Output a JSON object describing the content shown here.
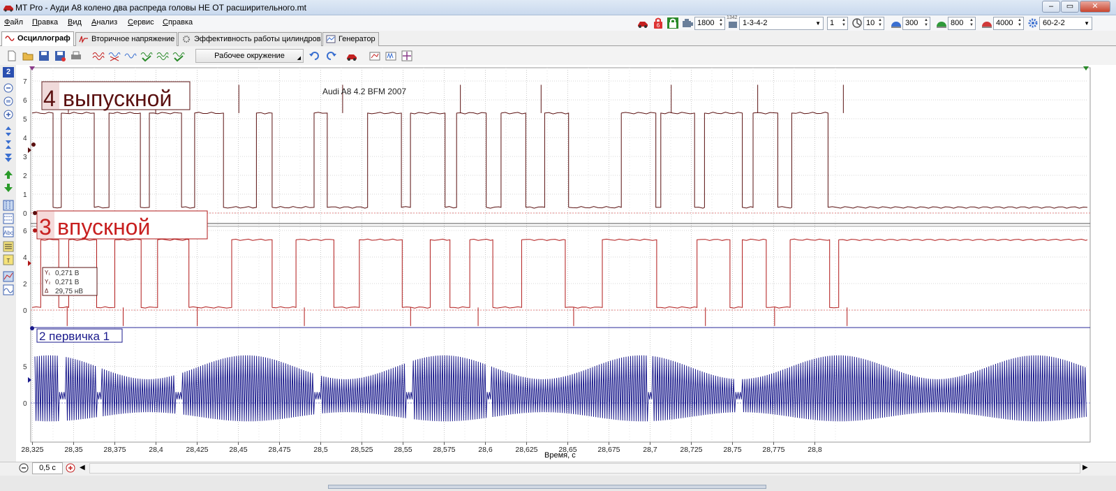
{
  "window": {
    "title": "MT Pro - Ауди А8 колено два распреда головы НЕ ОТ расширительного.mt",
    "minimize": "–",
    "maximize": "▭",
    "close": "✕"
  },
  "menu": {
    "items": [
      "Файл",
      "Правка",
      "Вид",
      "Анализ",
      "Сервис",
      "Справка"
    ]
  },
  "top_controls": {
    "rpm": "1800",
    "firing_order": "1-3-4-2",
    "cylinder": "1",
    "param_10": "10",
    "param_300": "300",
    "param_800": "800",
    "param_4000": "4000",
    "tooth_wheel": "60-2-2",
    "counter_icon_text": "1342"
  },
  "tabs": [
    {
      "label": "Осциллограф",
      "active": true
    },
    {
      "label": "Вторичное напряжение",
      "active": false
    },
    {
      "label": "Эффективность работы цилиндров",
      "active": false
    },
    {
      "label": "Генератор",
      "active": false
    }
  ],
  "toolbar": {
    "environment": "Рабочее окружение"
  },
  "left_panel": {
    "channel_number": "2"
  },
  "plot": {
    "annotation": "Audi A8 4.2 BFM 2007",
    "channel1_label": "4 выпускной",
    "channel1_digit": "4",
    "channel1_word": "выпускной",
    "channel2_label": "3 впускной",
    "channel2_digit": "3",
    "channel2_word": "впускной",
    "channel3_label": "2 первичка 1",
    "cursor_box": {
      "line1": "0,271 В",
      "line2": "0,271 В",
      "line3": "29,75 нВ"
    },
    "colors": {
      "channel1": "#5a1010",
      "channel2": "#b01818",
      "channel3": "#1a1a8c",
      "grid": "#c8c8c8",
      "ref_line": "#e08080"
    }
  },
  "chart_data": [
    {
      "type": "line",
      "title": "4 выпускной",
      "y_ticks": [
        "7",
        "6",
        "5",
        "4",
        "3",
        "2",
        "1",
        "0"
      ],
      "ylim": [
        0,
        7
      ],
      "x_ticks": [
        "28,325",
        "28,35",
        "28,375",
        "28,4",
        "28,425",
        "28,45",
        "28,475",
        "28,5",
        "28,525",
        "28,55",
        "28,575",
        "28,6",
        "28,625",
        "28,65",
        "28,675",
        "28,7",
        "28,725",
        "28,75",
        "28,775",
        "28,8"
      ],
      "xlabel": "Время, с",
      "high_level": 5.3,
      "low_level": 0.3,
      "edges": [
        {
          "x": 28.3248,
          "y": 5.3
        },
        {
          "x": 28.3375,
          "y": 0.3
        },
        {
          "x": 28.3425,
          "y": 5.3
        },
        {
          "x": 28.3625,
          "y": 0.3
        },
        {
          "x": 28.3715,
          "y": 5.3
        },
        {
          "x": 28.3905,
          "y": 0.3
        },
        {
          "x": 28.396,
          "y": 5.3
        },
        {
          "x": 28.4155,
          "y": 0.3
        },
        {
          "x": 28.4235,
          "y": 5.3
        },
        {
          "x": 28.441,
          "y": 0.3
        },
        {
          "x": 28.461,
          "y": 5.3
        },
        {
          "x": 28.4705,
          "y": 0.3
        },
        {
          "x": 28.496,
          "y": 5.3
        },
        {
          "x": 28.504,
          "y": 0.3
        },
        {
          "x": 28.5285,
          "y": 5.3
        },
        {
          "x": 28.549,
          "y": 0.3
        },
        {
          "x": 28.5545,
          "y": 5.3
        },
        {
          "x": 28.5755,
          "y": 0.3
        },
        {
          "x": 28.5825,
          "y": 5.3
        },
        {
          "x": 28.6005,
          "y": 0.3
        },
        {
          "x": 28.6095,
          "y": 5.3
        },
        {
          "x": 28.6245,
          "y": 0.3
        },
        {
          "x": 28.636,
          "y": 5.3
        },
        {
          "x": 28.6505,
          "y": 0.3
        },
        {
          "x": 28.6825,
          "y": 5.3
        },
        {
          "x": 28.7035,
          "y": 0.3
        },
        {
          "x": 28.7065,
          "y": 5.3
        },
        {
          "x": 28.727,
          "y": 0.3
        },
        {
          "x": 28.733,
          "y": 5.3
        },
        {
          "x": 28.756,
          "y": 0.3
        },
        {
          "x": 28.7625,
          "y": 5.3
        },
        {
          "x": 28.7775,
          "y": 0.3
        },
        {
          "x": 28.786,
          "y": 5.3
        },
        {
          "x": 28.808,
          "y": 0.3
        }
      ]
    },
    {
      "type": "line",
      "title": "3 впускной",
      "y_ticks": [
        "6",
        "4",
        "2",
        "0"
      ],
      "ylim": [
        0,
        6
      ],
      "high_level": 5.3,
      "low_level": 0.2,
      "edges": [
        {
          "x": 28.3248,
          "y": 0.2
        },
        {
          "x": 28.33,
          "y": 5.3
        },
        {
          "x": 28.341,
          "y": 0.2
        },
        {
          "x": 28.347,
          "y": 5.3
        },
        {
          "x": 28.364,
          "y": 0.2
        },
        {
          "x": 28.375,
          "y": 5.3
        },
        {
          "x": 28.391,
          "y": 0.2
        },
        {
          "x": 28.401,
          "y": 5.3
        },
        {
          "x": 28.42,
          "y": 0.2
        },
        {
          "x": 28.446,
          "y": 5.3
        },
        {
          "x": 28.4705,
          "y": 0.2
        },
        {
          "x": 28.485,
          "y": 5.3
        },
        {
          "x": 28.508,
          "y": 0.2
        },
        {
          "x": 28.5235,
          "y": 5.3
        },
        {
          "x": 28.5495,
          "y": 0.2
        },
        {
          "x": 28.5665,
          "y": 5.3
        },
        {
          "x": 28.5785,
          "y": 0.2
        },
        {
          "x": 28.5905,
          "y": 5.3
        },
        {
          "x": 28.6045,
          "y": 0.2
        },
        {
          "x": 28.622,
          "y": 5.3
        },
        {
          "x": 28.6485,
          "y": 0.2
        },
        {
          "x": 28.671,
          "y": 5.3
        },
        {
          "x": 28.704,
          "y": 0.2
        },
        {
          "x": 28.7285,
          "y": 5.3
        },
        {
          "x": 28.7485,
          "y": 0.2
        },
        {
          "x": 28.756,
          "y": 5.3
        },
        {
          "x": 28.7705,
          "y": 0.2
        },
        {
          "x": 28.785,
          "y": 5.3
        },
        {
          "x": 28.809,
          "y": 0.2
        },
        {
          "x": 28.8145,
          "y": 5.3
        }
      ]
    },
    {
      "type": "line",
      "title": "2 первичка 1",
      "y_ticks": [
        "5",
        "0"
      ],
      "ylim": [
        -2,
        8
      ],
      "amplitude_max": 6.5,
      "amplitude_min": -2.5,
      "periods_count": 470,
      "sync_gaps": [
        28.343,
        28.3655,
        28.4135,
        28.4975,
        28.5535,
        28.6015,
        28.6995,
        28.7535
      ]
    }
  ],
  "statusbar": {
    "timebase": "0,5 с"
  }
}
